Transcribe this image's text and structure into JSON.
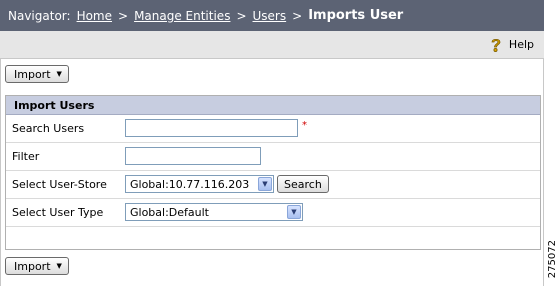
{
  "navigator": {
    "prefix": "Navigator:",
    "crumbs": [
      "Home",
      "Manage Entities",
      "Users"
    ],
    "separator": ">",
    "current": "Imports User"
  },
  "help": {
    "label": "Help",
    "icon": "help-question-icon"
  },
  "toolbar": {
    "import_top": "Import",
    "import_bottom": "Import"
  },
  "panel": {
    "title": "Import Users",
    "rows": {
      "search_users": {
        "label": "Search Users",
        "value": "",
        "required_marker": "*"
      },
      "filter": {
        "label": "Filter",
        "value": ""
      },
      "user_store": {
        "label": "Select User-Store",
        "selected": "Global:10.77.116.203",
        "button": "Search"
      },
      "user_type": {
        "label": "Select User Type",
        "selected": "Global:Default"
      }
    }
  },
  "figure_id": "275072"
}
